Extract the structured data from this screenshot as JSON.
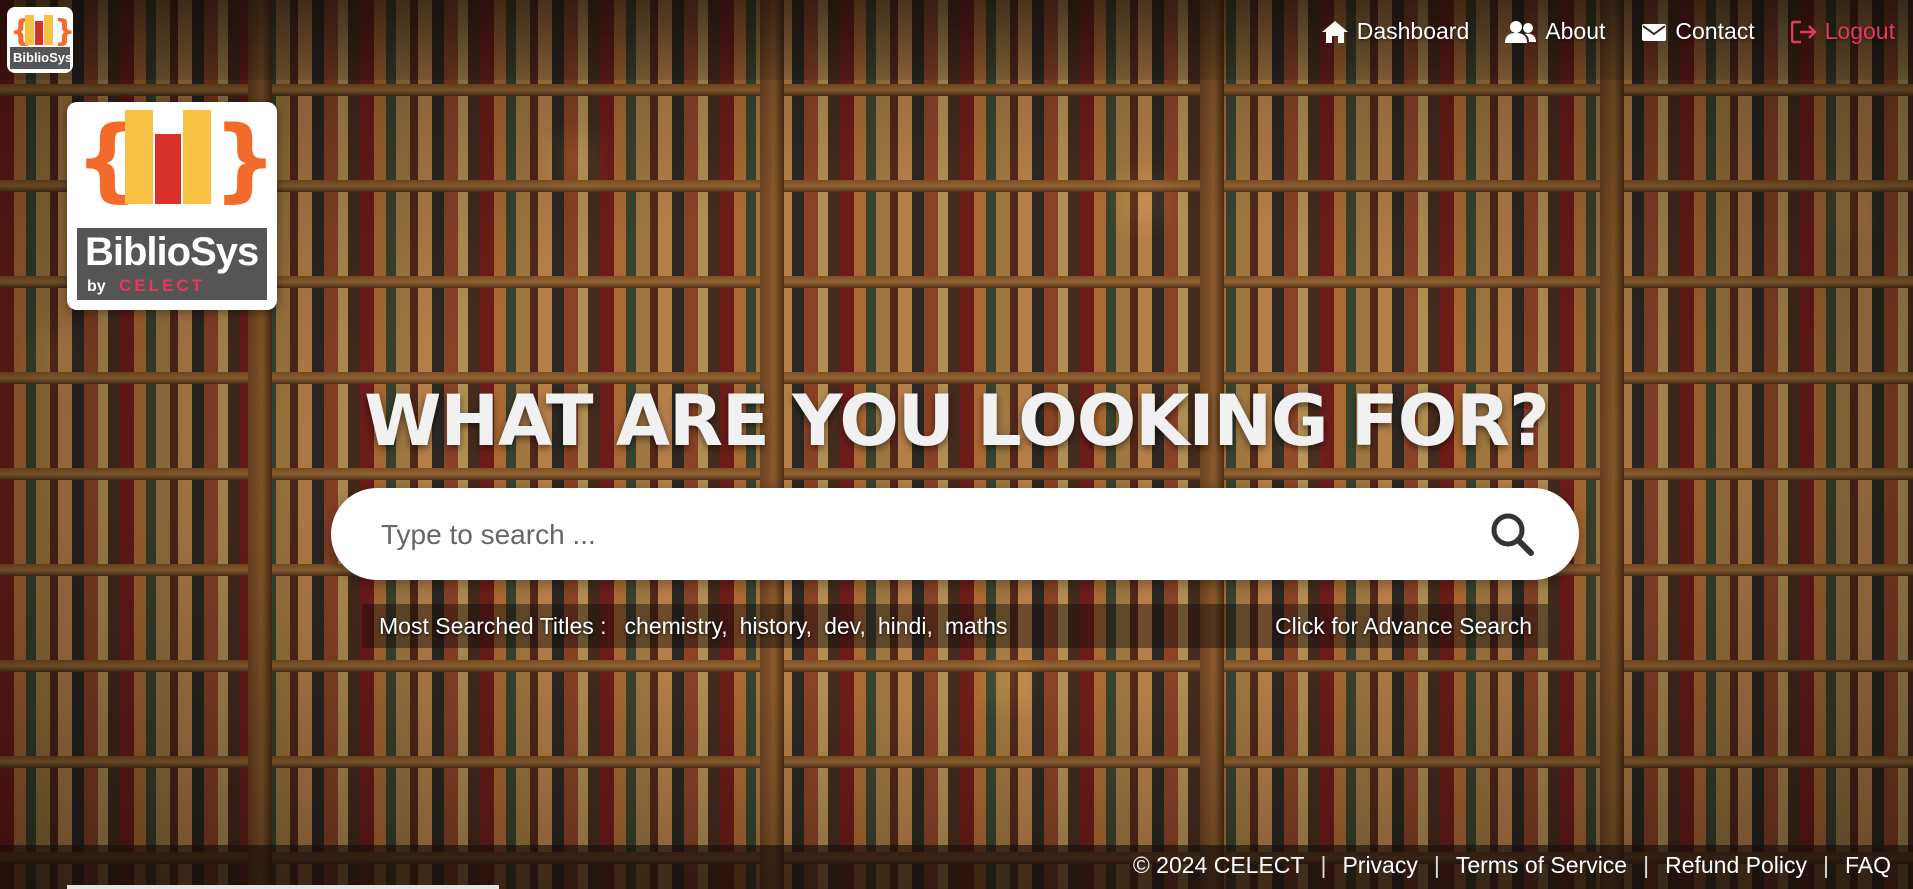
{
  "brand": {
    "name": "BiblioSys",
    "by": "by",
    "company": "CELECT"
  },
  "nav": {
    "items": [
      {
        "label": "Dashboard",
        "icon": "home-icon"
      },
      {
        "label": "About",
        "icon": "users-icon"
      },
      {
        "label": "Contact",
        "icon": "envelope-icon"
      },
      {
        "label": "Logout",
        "icon": "sign-out-icon"
      }
    ]
  },
  "hero": {
    "headline": "WHAT ARE YOU LOOKING FOR?"
  },
  "search": {
    "placeholder": "Type to search ...",
    "value": ""
  },
  "suggestions": {
    "label": "Most Searched Titles :",
    "titles": [
      "chemistry,",
      "history,",
      "dev,",
      "hindi,",
      "maths"
    ],
    "advanced_link": "Click for Advance Search"
  },
  "footer": {
    "copyright": "© 2024 CELECT",
    "links": [
      "Privacy",
      "Terms of Service",
      "Refund Policy",
      "FAQ"
    ],
    "separator": "|"
  },
  "colors": {
    "accent": "#e8385b",
    "logo_orange": "#f26b2a",
    "logo_yellow": "#f7c244",
    "logo_red": "#d8312b",
    "logo_band": "#555555"
  }
}
